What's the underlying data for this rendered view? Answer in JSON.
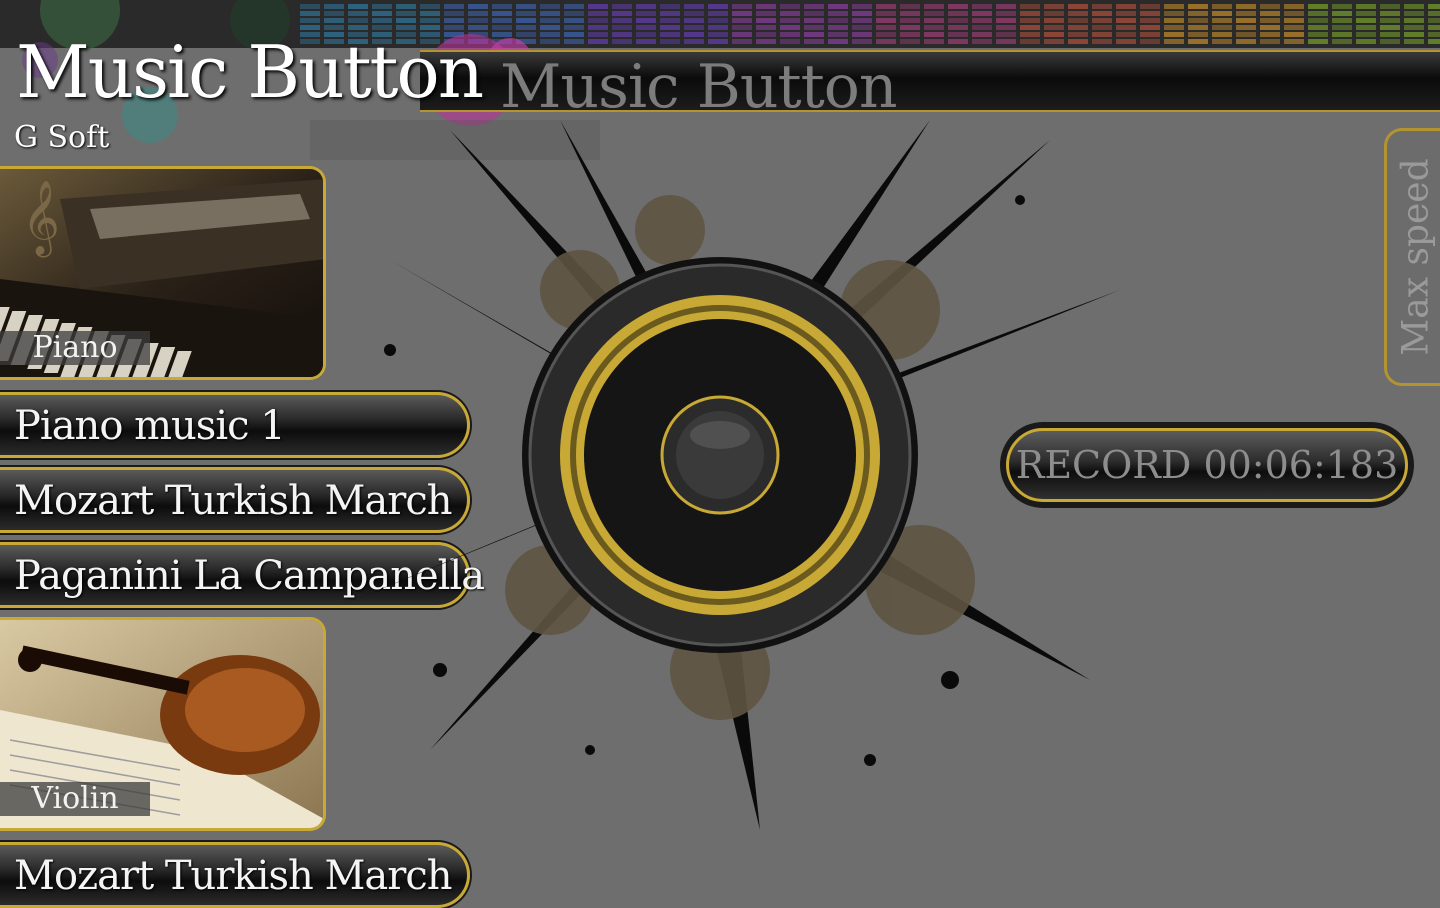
{
  "app": {
    "title": "Music Button",
    "subtitle": "G Soft",
    "header_bar_title": "Music Button"
  },
  "categories": [
    {
      "label": "Piano",
      "image": "piano-photo"
    },
    {
      "label": "Violin",
      "image": "violin-photo"
    }
  ],
  "songs": [
    {
      "label": "Piano music 1"
    },
    {
      "label": "Mozart Turkish March"
    },
    {
      "label": "Paganini La Campanella"
    },
    {
      "label": "Mozart Turkish March"
    }
  ],
  "controls": {
    "max_speed_label": "Max speed",
    "record_label": "RECORD 00:06:183"
  },
  "colors": {
    "accent_gold": "#c9a935",
    "background": "#6e6e6e",
    "button_dark": "#0c0c0c"
  },
  "icons": {
    "speaker": "speaker-icon",
    "equalizer": "equalizer-strip"
  }
}
